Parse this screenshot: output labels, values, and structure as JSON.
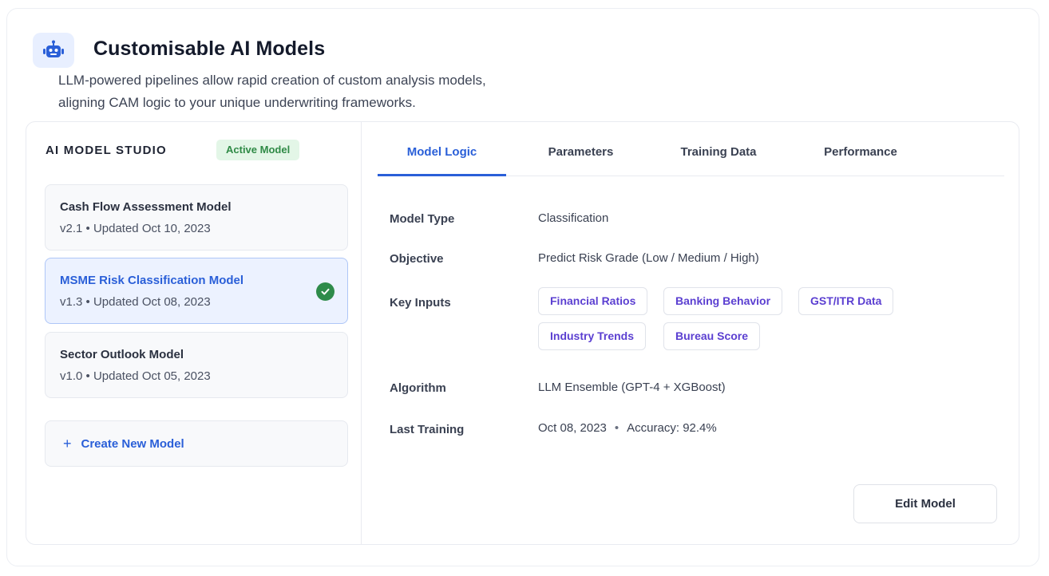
{
  "header": {
    "icon": "robot-icon",
    "title": "Customisable AI Models",
    "subtitle_line1": "LLM-powered pipelines allow rapid creation of custom analysis models,",
    "subtitle_line2": "aligning CAM logic to your unique underwriting frameworks."
  },
  "sidebar": {
    "heading": "AI MODEL STUDIO",
    "badge": "Active Model",
    "models": [
      {
        "name": "Cash Flow Assessment Model",
        "meta": "v2.1 • Updated Oct 10, 2023",
        "selected": false
      },
      {
        "name": "MSME Risk Classification Model",
        "meta": "v1.3 • Updated Oct 08, 2023",
        "selected": true
      },
      {
        "name": "Sector Outlook Model",
        "meta": "v1.0 • Updated Oct 05, 2023",
        "selected": false
      }
    ],
    "create_label": "Create New Model"
  },
  "tabs": [
    {
      "label": "Model Logic",
      "active": true
    },
    {
      "label": "Parameters",
      "active": false
    },
    {
      "label": "Training Data",
      "active": false
    },
    {
      "label": "Performance",
      "active": false
    }
  ],
  "details": {
    "model_type_label": "Model Type",
    "model_type_value": "Classification",
    "objective_label": "Objective",
    "objective_value": "Predict Risk Grade (Low / Medium / High)",
    "key_inputs_label": "Key Inputs",
    "key_inputs": [
      "Financial Ratios",
      "Banking Behavior",
      "GST/ITR Data",
      "Industry Trends",
      "Bureau Score"
    ],
    "algorithm_label": "Algorithm",
    "algorithm_value": "LLM Ensemble (GPT-4 + XGBoost)",
    "last_training_label": "Last Training",
    "last_training_date": "Oct 08, 2023",
    "separator": "•",
    "accuracy": "Accuracy: 92.4%"
  },
  "actions": {
    "edit_label": "Edit Model"
  },
  "colors": {
    "accent": "#2a5fd8",
    "chip_text": "#5b3fd1",
    "success": "#2e8b4a",
    "badge_bg": "#e3f6e7"
  }
}
